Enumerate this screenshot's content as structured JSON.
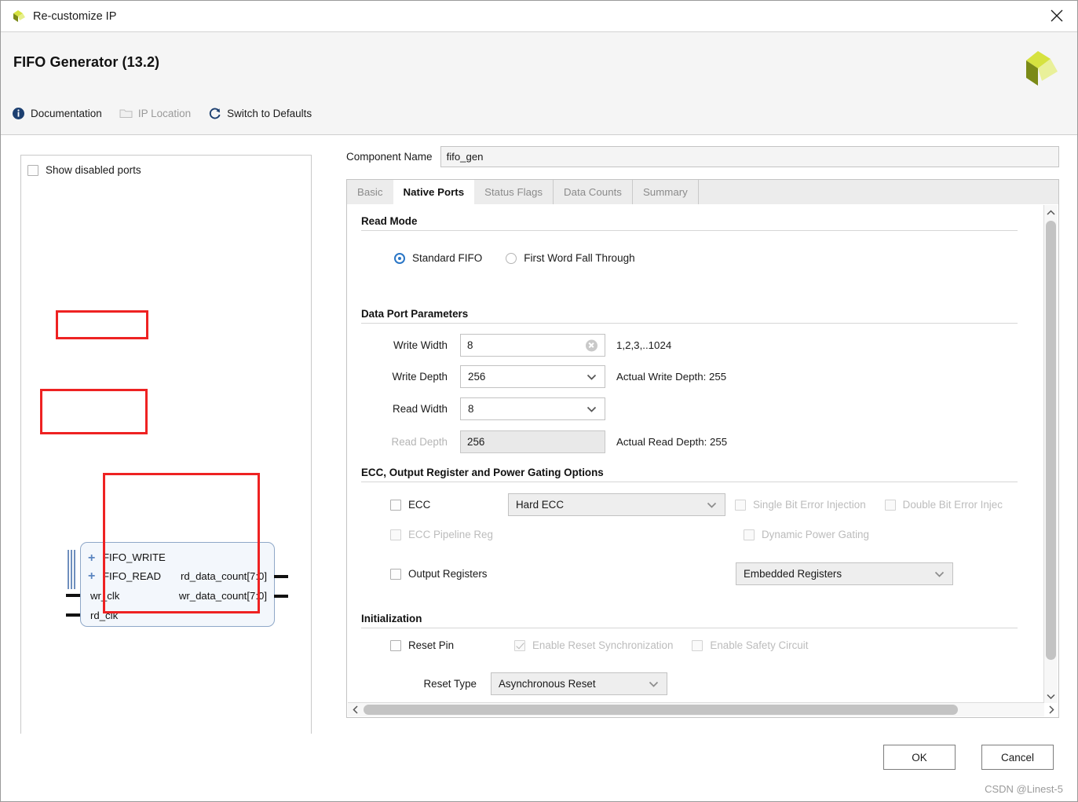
{
  "window": {
    "title": "Re-customize IP",
    "close_icon": "close-icon"
  },
  "header": {
    "ip_title": "FIFO Generator (13.2)",
    "logo": "xilinx-logo",
    "links": [
      {
        "label": "Documentation",
        "icon": "info-icon",
        "disabled": false
      },
      {
        "label": "IP Location",
        "icon": "folder-icon",
        "disabled": true
      },
      {
        "label": "Switch to Defaults",
        "icon": "refresh-icon",
        "disabled": false
      }
    ]
  },
  "left_panel": {
    "show_disabled_ports": {
      "label": "Show disabled ports",
      "checked": false
    },
    "symbol": {
      "bus_ports": [
        {
          "label": "FIFO_WRITE",
          "expander": "+"
        },
        {
          "label": "FIFO_READ",
          "expander": "+"
        }
      ],
      "input_pins": [
        "wr_clk",
        "rd_clk"
      ],
      "output_pins": [
        "rd_data_count[7:0]",
        "wr_data_count[7:0]"
      ]
    }
  },
  "component": {
    "label": "Component Name",
    "value": "fifo_gen"
  },
  "tabs": [
    {
      "label": "Basic",
      "active": false
    },
    {
      "label": "Native Ports",
      "active": true
    },
    {
      "label": "Status Flags",
      "active": false
    },
    {
      "label": "Data Counts",
      "active": false
    },
    {
      "label": "Summary",
      "active": false
    }
  ],
  "read_mode": {
    "title": "Read Mode",
    "options": [
      {
        "label": "Standard FIFO",
        "selected": true
      },
      {
        "label": "First Word Fall Through",
        "selected": false
      }
    ]
  },
  "data_port": {
    "title": "Data Port Parameters",
    "rows": [
      {
        "label": "Write Width",
        "value": "8",
        "kind": "text",
        "disabled": false,
        "hint": "1,2,3,..1024",
        "clearable": true
      },
      {
        "label": "Write Depth",
        "value": "256",
        "kind": "combo",
        "disabled": false,
        "hint": "Actual Write Depth: 255",
        "clearable": false
      },
      {
        "label": "Read Width",
        "value": "8",
        "kind": "combo",
        "disabled": false,
        "hint": "",
        "clearable": false
      },
      {
        "label": "Read Depth",
        "value": "256",
        "kind": "text",
        "disabled": true,
        "hint": "Actual Read Depth: 255",
        "clearable": false
      }
    ]
  },
  "ecc": {
    "title": "ECC, Output Register and Power Gating Options",
    "ecc_checkbox": {
      "label": "ECC",
      "checked": false,
      "disabled": false
    },
    "ecc_mode": {
      "value": "Hard ECC",
      "disabled": true
    },
    "single_bit": {
      "label": "Single Bit Error Injection",
      "checked": false,
      "disabled": true
    },
    "double_bit": {
      "label": "Double Bit Error Injec",
      "checked": false,
      "disabled": true
    },
    "pipeline_reg": {
      "label": "ECC Pipeline Reg",
      "checked": false,
      "disabled": true
    },
    "dynamic_power_gating": {
      "label": "Dynamic Power Gating",
      "checked": false,
      "disabled": true
    },
    "output_registers": {
      "label": "Output Registers",
      "checked": false,
      "disabled": false
    },
    "output_reg_mode": {
      "value": "Embedded Registers",
      "disabled": true
    }
  },
  "initialization": {
    "title": "Initialization",
    "reset_pin": {
      "label": "Reset Pin",
      "checked": false,
      "disabled": false
    },
    "reset_sync": {
      "label": "Enable Reset Synchronization",
      "checked": true,
      "disabled": true
    },
    "safety_circuit": {
      "label": "Enable Safety Circuit",
      "checked": false,
      "disabled": true
    },
    "reset_type_label": "Reset Type",
    "reset_type_value": "Asynchronous Reset"
  },
  "footer": {
    "ok_label": "OK",
    "cancel_label": "Cancel",
    "watermark": "CSDN @Linest-5"
  },
  "colors": {
    "annotation": "#ee2222",
    "accent": "#2a76c6",
    "logo_light": "#d6e23f",
    "logo_dark": "#7b8a17"
  }
}
